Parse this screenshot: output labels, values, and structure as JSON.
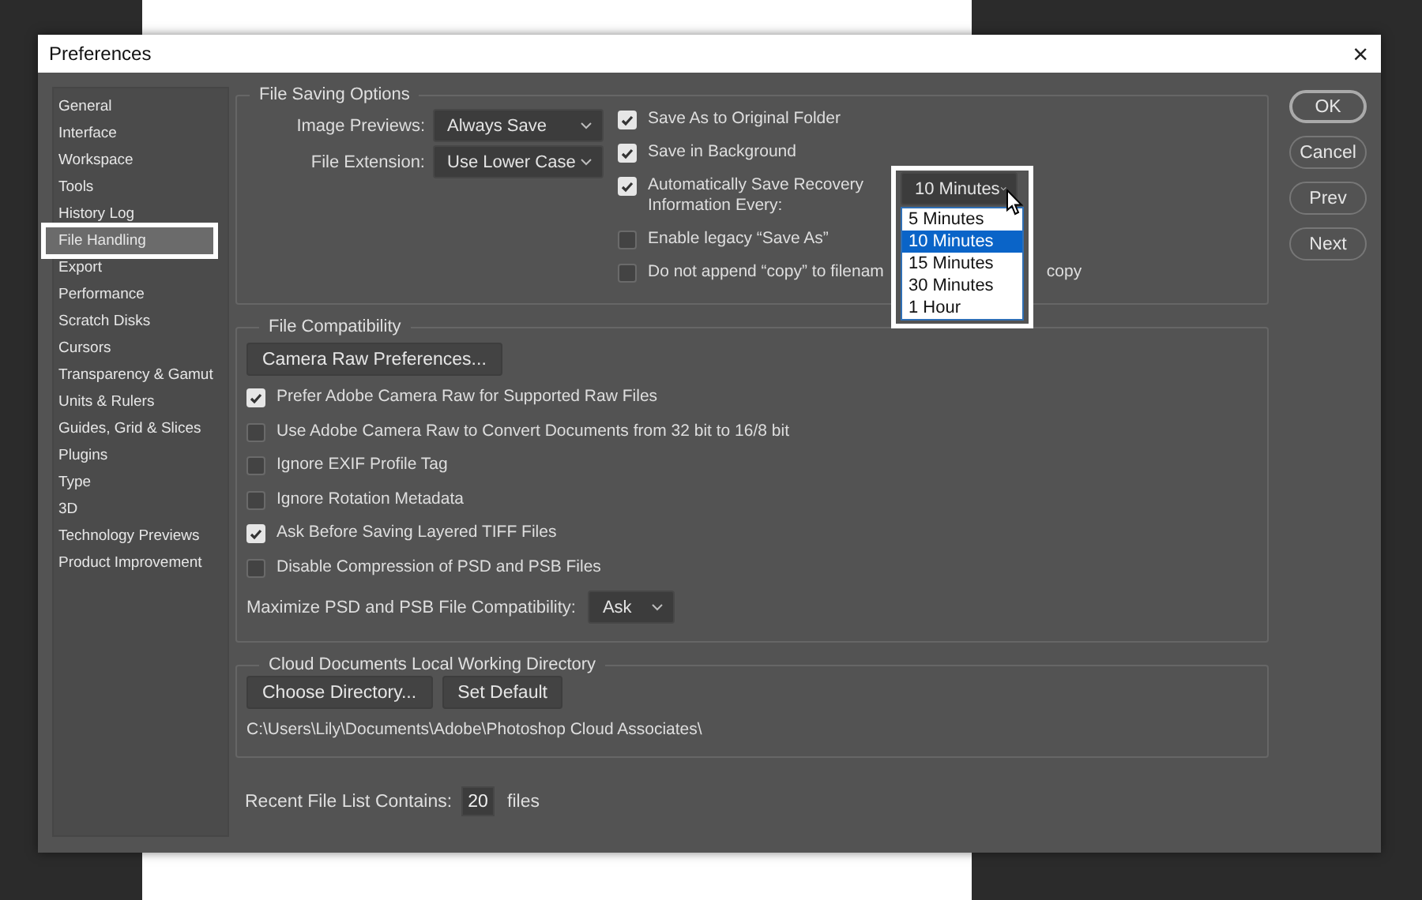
{
  "window": {
    "title": "Preferences",
    "close": "×"
  },
  "sidebar": {
    "items": [
      {
        "label": "General",
        "selected": false,
        "highlighted": false
      },
      {
        "label": "Interface",
        "selected": false,
        "highlighted": false
      },
      {
        "label": "Workspace",
        "selected": false,
        "highlighted": false
      },
      {
        "label": "Tools",
        "selected": false,
        "highlighted": false
      },
      {
        "label": "History Log",
        "selected": false,
        "highlighted": false
      },
      {
        "label": "File Handling",
        "selected": true,
        "highlighted": true
      },
      {
        "label": "Export",
        "selected": false,
        "highlighted": false
      },
      {
        "label": "Performance",
        "selected": false,
        "highlighted": false
      },
      {
        "label": "Scratch Disks",
        "selected": false,
        "highlighted": false
      },
      {
        "label": "Cursors",
        "selected": false,
        "highlighted": false
      },
      {
        "label": "Transparency & Gamut",
        "selected": false,
        "highlighted": false
      },
      {
        "label": "Units & Rulers",
        "selected": false,
        "highlighted": false
      },
      {
        "label": "Guides, Grid & Slices",
        "selected": false,
        "highlighted": false
      },
      {
        "label": "Plugins",
        "selected": false,
        "highlighted": false
      },
      {
        "label": "Type",
        "selected": false,
        "highlighted": false
      },
      {
        "label": "3D",
        "selected": false,
        "highlighted": false
      },
      {
        "label": "Technology Previews",
        "selected": false,
        "highlighted": false
      },
      {
        "label": "Product Improvement",
        "selected": false,
        "highlighted": false
      }
    ]
  },
  "file_saving_options": {
    "title": "File Saving Options",
    "selects": [
      {
        "label": "Image Previews:",
        "value": "Always Save"
      },
      {
        "label": "File Extension:",
        "value": "Use Lower Case"
      }
    ],
    "checkboxes": [
      {
        "kind": "plain",
        "label": "Save As to Original Folder",
        "checked": true
      },
      {
        "kind": "plain",
        "label": "Save in Background",
        "checked": true
      },
      {
        "kind": "recovery",
        "label": "Automatically Save Recovery Information Every:",
        "checked": true
      },
      {
        "kind": "plain",
        "label": "Enable legacy “Save As”",
        "checked": false
      },
      {
        "kind": "split",
        "label": "Do not append “copy” to filenam",
        "trailing": "copy",
        "checked": false
      }
    ],
    "recovery_interval": {
      "value": "10 Minutes",
      "expanded": true,
      "highlighted": true,
      "options": [
        {
          "label": "5 Minutes",
          "selected": false
        },
        {
          "label": "10 Minutes",
          "selected": true
        },
        {
          "label": "15 Minutes",
          "selected": false
        },
        {
          "label": "30 Minutes",
          "selected": false
        },
        {
          "label": "1 Hour",
          "selected": false
        }
      ]
    }
  },
  "file_compatibility": {
    "title": "File Compatibility",
    "button": "Camera Raw Preferences...",
    "checkboxes": [
      {
        "label": "Prefer Adobe Camera Raw for Supported Raw Files",
        "checked": true
      },
      {
        "label": "Use Adobe Camera Raw to Convert Documents from 32 bit to 16/8 bit",
        "checked": false
      },
      {
        "label": "Ignore EXIF Profile Tag",
        "checked": false
      },
      {
        "label": "Ignore Rotation Metadata",
        "checked": false
      },
      {
        "label": "Ask Before Saving Layered TIFF Files",
        "checked": true
      },
      {
        "label": "Disable Compression of PSD and PSB Files",
        "checked": false
      }
    ],
    "maximize": {
      "label": "Maximize PSD and PSB File Compatibility:",
      "value": "Ask"
    }
  },
  "cloud_documents": {
    "title": "Cloud Documents Local Working Directory",
    "buttons": [
      "Choose Directory...",
      "Set Default"
    ],
    "path": "C:\\Users\\Lily\\Documents\\Adobe\\Photoshop Cloud Associates\\"
  },
  "recent_files": {
    "label": "Recent File List Contains:",
    "value": "20",
    "unit": "files"
  },
  "buttons": [
    {
      "label": "OK",
      "default": true
    },
    {
      "label": "Cancel",
      "default": false
    },
    {
      "label": "Prev",
      "default": false
    },
    {
      "label": "Next",
      "default": false
    }
  ]
}
